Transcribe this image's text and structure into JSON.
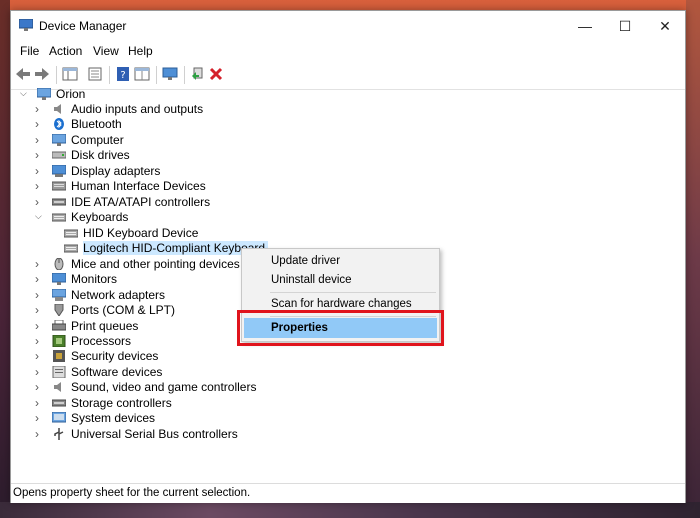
{
  "window": {
    "title": "Device Manager",
    "controls": {
      "minimize": "—",
      "maximize": "☐",
      "close": "✕"
    }
  },
  "menubar": [
    "File",
    "Action",
    "View",
    "Help"
  ],
  "toolbar": {
    "icons": [
      "back-arrow-icon",
      "forward-arrow-icon",
      "show-hide-tree-icon",
      "properties-sheet-icon",
      "help-icon",
      "view-icon",
      "monitor-scan-icon",
      "update-driver-icon",
      "uninstall-icon"
    ]
  },
  "tree": {
    "root": "Orion",
    "categories": [
      "Audio inputs and outputs",
      "Bluetooth",
      "Computer",
      "Disk drives",
      "Display adapters",
      "Human Interface Devices",
      "IDE ATA/ATAPI controllers",
      "Keyboards",
      "Mice and other pointing devices",
      "Monitors",
      "Network adapters",
      "Ports (COM & LPT)",
      "Print queues",
      "Processors",
      "Security devices",
      "Software devices",
      "Sound, video and game controllers",
      "Storage controllers",
      "System devices",
      "Universal Serial Bus controllers"
    ],
    "keyboard_children": [
      "HID Keyboard Device",
      "Logitech HID-Compliant Keyboard"
    ],
    "selected": "Logitech HID-Compliant Keyboard"
  },
  "context_menu": {
    "items": [
      "Update driver",
      "Uninstall device",
      "Scan for hardware changes",
      "Properties"
    ],
    "highlighted": "Properties"
  },
  "status_bar": "Opens property sheet for the current selection.",
  "colors": {
    "selection": "#cce8ff",
    "menu_highlight": "#91c9f7",
    "annotation_box": "#e0141c"
  }
}
